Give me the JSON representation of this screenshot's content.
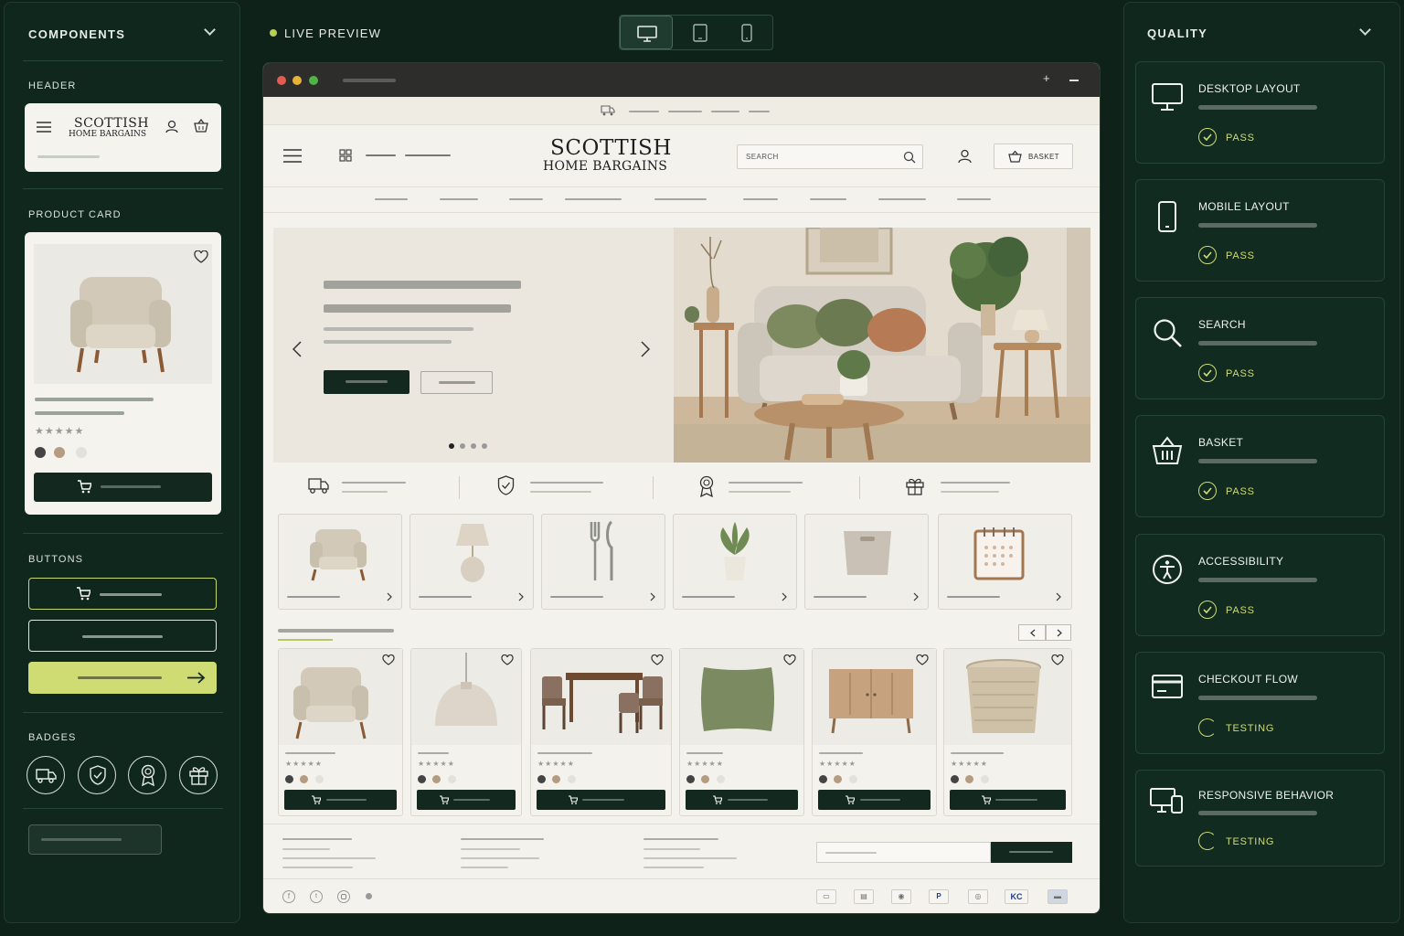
{
  "left_panel": {
    "title": "COMPONENTS",
    "header_section": "HEADER",
    "header_logo_line1": "SCOTTISH",
    "header_logo_line2": "HOME BARGAINS",
    "product_card_section": "PRODUCT CARD",
    "buttons_section": "BUTTONS",
    "badges_section": "BADGES"
  },
  "toolbar": {
    "live_preview": "LIVE PREVIEW",
    "views": [
      "desktop-icon",
      "tablet-icon",
      "mobile-icon"
    ],
    "active_view": "desktop"
  },
  "site": {
    "logo_line1": "SCOTTISH",
    "logo_line2": "HOME BARGAINS",
    "search_placeholder": "SEARCH",
    "basket_label": "BASKET"
  },
  "quality": {
    "title": "QUALITY",
    "checks": [
      {
        "label": "DESKTOP LAYOUT",
        "status": "PASS",
        "icon": "monitor-icon"
      },
      {
        "label": "MOBILE LAYOUT",
        "status": "PASS",
        "icon": "phone-icon"
      },
      {
        "label": "SEARCH",
        "status": "PASS",
        "icon": "search-icon"
      },
      {
        "label": "BASKET",
        "status": "PASS",
        "icon": "basket-icon"
      },
      {
        "label": "ACCESSIBILITY",
        "status": "PASS",
        "icon": "accessibility-icon"
      },
      {
        "label": "CHECKOUT FLOW",
        "status": "TESTING",
        "icon": "card-icon"
      },
      {
        "label": "RESPONSIVE BEHAVIOR",
        "status": "TESTING",
        "icon": "devices-icon"
      }
    ]
  },
  "colors": {
    "background": "#0e2219",
    "accent_lime": "#cfdc74",
    "dark_green": "#13291f",
    "page_cream": "#f4f2ec"
  },
  "footer_payment_badges": [
    "card-icon",
    "wallet-icon",
    "apple-pay-icon",
    "P",
    "globe-icon",
    "KC",
    "bank-icon"
  ]
}
